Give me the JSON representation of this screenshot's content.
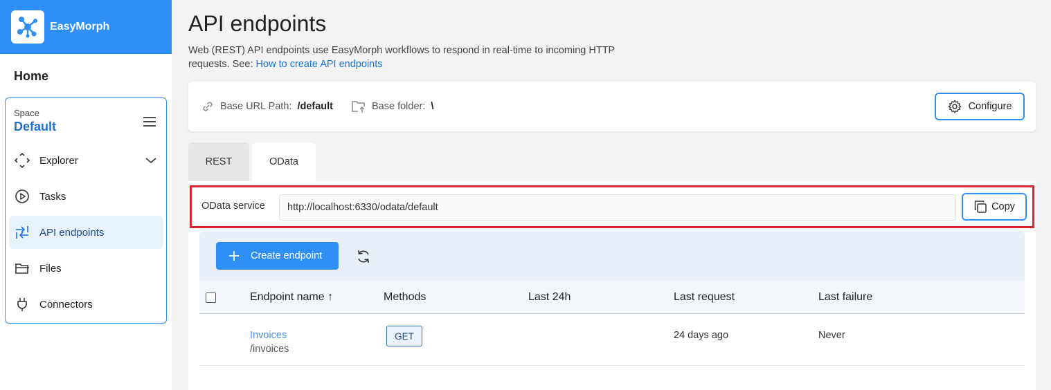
{
  "brand": {
    "name": "EasyMorph"
  },
  "sidebar": {
    "home": "Home",
    "space_label": "Space",
    "space_name": "Default",
    "items": [
      {
        "label": "Explorer",
        "icon": "explorer-icon"
      },
      {
        "label": "Tasks",
        "icon": "play-circle-icon"
      },
      {
        "label": "API endpoints",
        "icon": "arrows-icon",
        "active": true
      },
      {
        "label": "Files",
        "icon": "folder-icon"
      },
      {
        "label": "Connectors",
        "icon": "plug-icon"
      }
    ]
  },
  "page": {
    "title": "API endpoints",
    "description": "Web (REST) API endpoints use EasyMorph workflows to respond in real-time to incoming HTTP requests. See: ",
    "link": "How to create API endpoints"
  },
  "info": {
    "base_url_label": "Base URL Path:",
    "base_url_value": "/default",
    "base_folder_label": "Base folder:",
    "base_folder_value": "\\",
    "configure_label": "Configure"
  },
  "tabs": [
    {
      "label": "REST"
    },
    {
      "label": "OData",
      "active": true
    }
  ],
  "odata": {
    "label": "OData service",
    "url": "http://localhost:6330/odata/default",
    "copy_label": "Copy"
  },
  "toolbar": {
    "create_label": "Create endpoint"
  },
  "table": {
    "columns": [
      "Endpoint name",
      "Methods",
      "Last 24h",
      "Last request",
      "Last failure"
    ],
    "sort_indicator": "↑",
    "rows": [
      {
        "name": "Invoices",
        "path": "/invoices",
        "method": "GET",
        "last24h": "",
        "last_request": "24 days ago",
        "last_failure": "Never"
      }
    ]
  },
  "colors": {
    "brand": "#2f8ff7",
    "highlight": "#d9262c",
    "link": "#4a90e2"
  }
}
